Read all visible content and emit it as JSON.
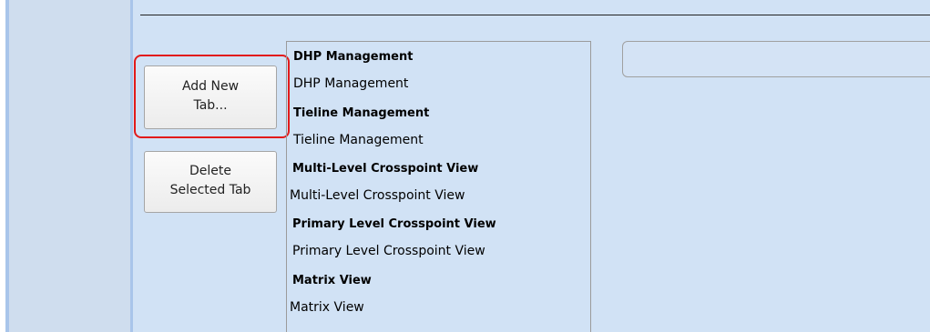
{
  "buttons": {
    "add_new_tab": "Add New\nTab...",
    "delete_selected_tab": "Delete\nSelected Tab"
  },
  "tab_list": [
    {
      "label": "DHP Management",
      "bold": true
    },
    {
      "label": "DHP Management",
      "bold": false
    },
    {
      "label": "Tieline Management",
      "bold": true
    },
    {
      "label": "Tieline Management",
      "bold": false
    },
    {
      "label": "Multi-Level Crosspoint View",
      "bold": true
    },
    {
      "label": "Multi-Level Crosspoint View",
      "bold": false
    },
    {
      "label": "Primary Level Crosspoint View",
      "bold": true
    },
    {
      "label": "Primary Level Crosspoint View",
      "bold": false
    },
    {
      "label": "Matrix View",
      "bold": true
    },
    {
      "label": "Matrix View",
      "bold": false
    }
  ],
  "tab_name_field": {
    "value": ""
  },
  "colors": {
    "content_background": "#d1e2f5",
    "nav_background": "#cfddee",
    "highlight": "#e21a1a"
  }
}
